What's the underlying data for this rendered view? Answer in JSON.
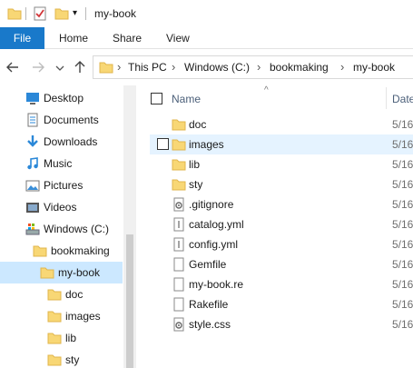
{
  "window": {
    "title": "my-book"
  },
  "ribbon": {
    "tabs": [
      "File",
      "Home",
      "Share",
      "View"
    ]
  },
  "address": {
    "crumbs": [
      "This PC",
      "Windows (C:)",
      "bookmaking",
      "my-book"
    ]
  },
  "sidebar": {
    "items": [
      {
        "label": "Desktop",
        "icon": "desktop-icon"
      },
      {
        "label": "Documents",
        "icon": "documents-icon"
      },
      {
        "label": "Downloads",
        "icon": "downloads-icon"
      },
      {
        "label": "Music",
        "icon": "music-icon"
      },
      {
        "label": "Pictures",
        "icon": "pictures-icon"
      },
      {
        "label": "Videos",
        "icon": "videos-icon"
      },
      {
        "label": "Windows (C:)",
        "icon": "drive-icon"
      },
      {
        "label": "bookmaking",
        "icon": "folder-icon"
      },
      {
        "label": "my-book",
        "icon": "folder-icon",
        "selected": true
      },
      {
        "label": "doc",
        "icon": "folder-icon"
      },
      {
        "label": "images",
        "icon": "folder-icon"
      },
      {
        "label": "lib",
        "icon": "folder-icon"
      },
      {
        "label": "sty",
        "icon": "folder-icon"
      }
    ]
  },
  "list": {
    "columns": {
      "name": "Name",
      "date": "Date"
    },
    "rows": [
      {
        "name": "doc",
        "date": "5/16",
        "icon": "folder-icon"
      },
      {
        "name": "images",
        "date": "5/16",
        "icon": "folder-icon",
        "hover": true
      },
      {
        "name": "lib",
        "date": "5/16",
        "icon": "folder-icon"
      },
      {
        "name": "sty",
        "date": "5/16",
        "icon": "folder-icon"
      },
      {
        "name": ".gitignore",
        "date": "5/16",
        "icon": "settings-file-icon"
      },
      {
        "name": "catalog.yml",
        "date": "5/16",
        "icon": "text-file-icon"
      },
      {
        "name": "config.yml",
        "date": "5/16",
        "icon": "text-file-icon"
      },
      {
        "name": "Gemfile",
        "date": "5/16",
        "icon": "blank-file-icon"
      },
      {
        "name": "my-book.re",
        "date": "5/16",
        "icon": "blank-file-icon"
      },
      {
        "name": "Rakefile",
        "date": "5/16",
        "icon": "blank-file-icon"
      },
      {
        "name": "style.css",
        "date": "5/16",
        "icon": "settings-file-icon"
      }
    ]
  },
  "colors": {
    "accent": "#1979ca",
    "folder": "#f8d775",
    "selection": "#cce8ff",
    "hover": "#e5f3ff"
  }
}
